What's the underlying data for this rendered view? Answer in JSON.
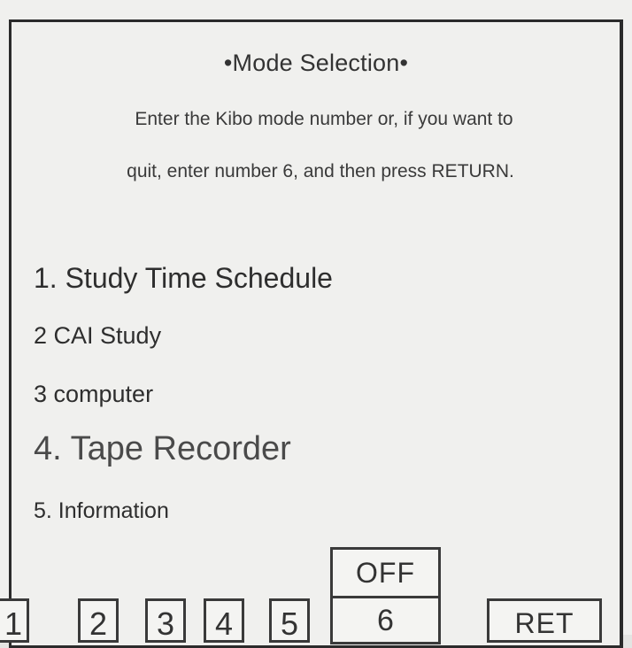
{
  "screen": {
    "title": "•Mode Selection•",
    "instruction_line1": "Enter the Kibo mode number or, if you want to",
    "instruction_line2": "quit, enter number 6, and then press RETURN."
  },
  "menu": {
    "items": [
      {
        "label": "1. Study Time Schedule"
      },
      {
        "label": "2 CAI Study"
      },
      {
        "label": "3 computer"
      },
      {
        "label": "4. Tape Recorder"
      },
      {
        "label": "5. Information"
      }
    ]
  },
  "keypad": {
    "keys": [
      {
        "label": "1"
      },
      {
        "label": "2"
      },
      {
        "label": "3"
      },
      {
        "label": "4"
      },
      {
        "label": "5"
      }
    ],
    "off_label": "OFF",
    "six_label": "6",
    "return_label": "RET"
  }
}
